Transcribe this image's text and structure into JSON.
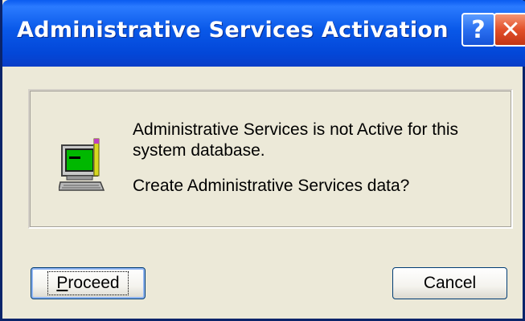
{
  "window": {
    "title": "Administrative Services Activation",
    "help_glyph": "?",
    "close_glyph": "✕"
  },
  "message": {
    "line1": "Administrative Services is not Active for this system database.",
    "line2": "Create Administrative Services data?"
  },
  "buttons": {
    "proceed": {
      "mnemonic": "P",
      "rest": "roceed"
    },
    "cancel": {
      "label": "Cancel"
    }
  },
  "icons": {
    "title_help": "help-icon",
    "title_close": "close-icon",
    "dialog": "computer-terminal-icon"
  },
  "colors": {
    "titlebar": "#0958e8",
    "close_button": "#e2502a",
    "dialog_background": "#ece9d8",
    "focus_border": "#003c74"
  }
}
